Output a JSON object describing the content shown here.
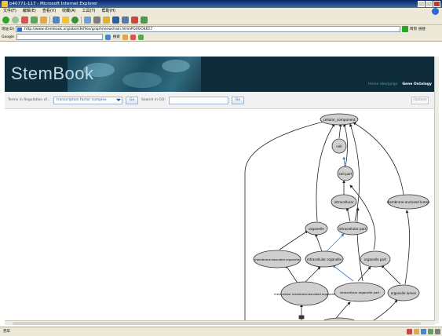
{
  "window": {
    "title": "b40771-117 - Microsoft Internet Explorer"
  },
  "menu": [
    "文件(F)",
    "编辑(E)",
    "查看(V)",
    "收藏(A)",
    "工具(T)",
    "帮助(H)"
  ],
  "address": {
    "label": "地址(D)",
    "url": "http://www.stembook.org/obo/stkfiles/graph/viewchain.html#G0GO4617",
    "go_label": "转到",
    "links_label": "链接"
  },
  "googlebar": {
    "label": "Google",
    "search_btn": "搜索"
  },
  "site": {
    "logo": "StemBook",
    "nav_home": "Home obo/go/go",
    "nav_ontology": "Gene Ontology"
  },
  "controls": {
    "terms_label": "Terms in Regulation of...",
    "select_value": "transcription factor complex",
    "button_go": "Go",
    "search_label": "Search in GO:",
    "search_value": "",
    "search_btn": "Go",
    "options_btn": "Options"
  },
  "graph": {
    "nodes": [
      {
        "id": "n_root",
        "label": "cellular_component"
      },
      {
        "id": "n_cell",
        "label": "cell"
      },
      {
        "id": "n_cellpart",
        "label": "cell part"
      },
      {
        "id": "n_intracellular",
        "label": "intracellular"
      },
      {
        "id": "n_organelle",
        "label": "organelle"
      },
      {
        "id": "n_intracellular_part",
        "label": "intracellular part"
      },
      {
        "id": "n_membrane_enclosed_lumen",
        "label": "membrane-enclosed lumen"
      },
      {
        "id": "n_membrane_bounded_organelle",
        "label": "membrane-bounded organelle"
      },
      {
        "id": "n_intracellular_organelle",
        "label": "intracellular organelle"
      },
      {
        "id": "n_organelle_part",
        "label": "organelle part"
      },
      {
        "id": "n_intra_membrane_bounded",
        "label": "intracellular membrane-bounded organelle"
      },
      {
        "id": "n_intra_organelle_part",
        "label": "intracellular organelle part"
      },
      {
        "id": "n_organelle_lumen",
        "label": "organelle lumen"
      }
    ]
  },
  "statusbar": {
    "text": "完毕"
  }
}
